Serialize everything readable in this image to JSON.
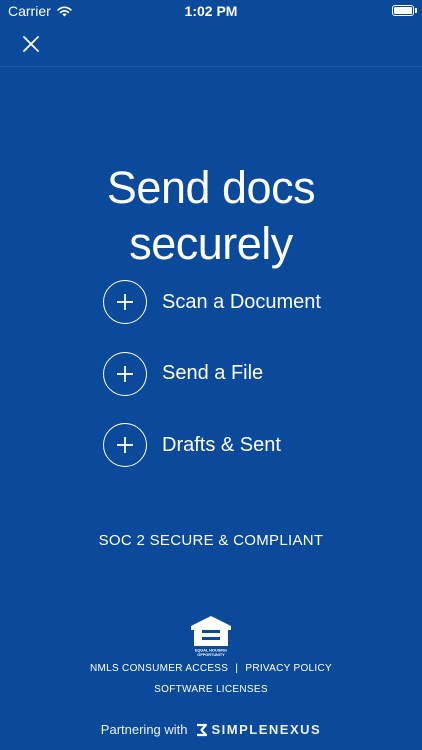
{
  "status_bar": {
    "carrier": "Carrier",
    "time": "1:02 PM",
    "battery_level": 1.0
  },
  "nav": {
    "close_icon": "close-icon"
  },
  "headline": {
    "line1": "Send docs",
    "line2": "securely"
  },
  "actions": [
    {
      "label": "Scan a Document",
      "icon": "plus-icon"
    },
    {
      "label": "Send a File",
      "icon": "plus-icon"
    },
    {
      "label": "Drafts & Sent",
      "icon": "plus-icon"
    }
  ],
  "compliance_text": "SOC 2 SECURE & COMPLIANT",
  "footer": {
    "eho_logo_text": "EQUAL HOUSING OPPORTUNITY",
    "link_nmls": "NMLS CONSUMER ACCESS",
    "separator": "|",
    "link_privacy": "PRIVACY POLICY",
    "link_licenses": "SOFTWARE LICENSES",
    "partner_prefix": "Partnering with",
    "partner_brand": "SIMPLENEXUS"
  },
  "colors": {
    "background": "#0b4a9a",
    "foreground": "#ffffff"
  }
}
